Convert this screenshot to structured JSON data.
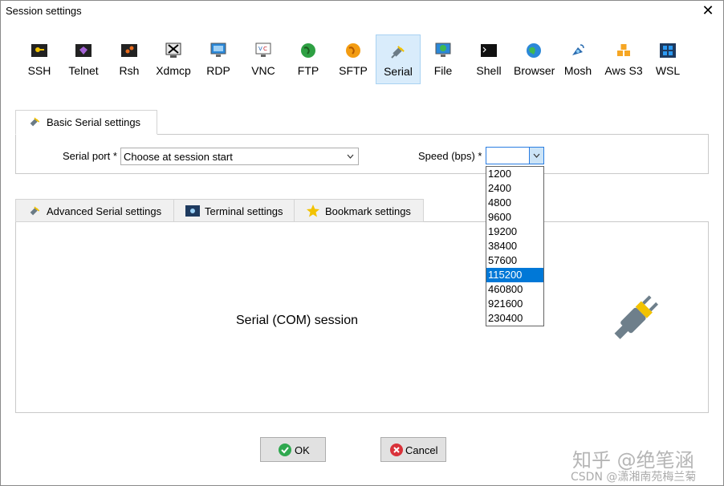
{
  "window": {
    "title": "Session settings"
  },
  "toolbar": {
    "items": [
      {
        "label": "SSH",
        "icon": "key-icon"
      },
      {
        "label": "Telnet",
        "icon": "telnet-icon"
      },
      {
        "label": "Rsh",
        "icon": "rsh-icon"
      },
      {
        "label": "Xdmcp",
        "icon": "xdmcp-icon"
      },
      {
        "label": "RDP",
        "icon": "rdp-monitor-icon"
      },
      {
        "label": "VNC",
        "icon": "vnc-monitor-icon"
      },
      {
        "label": "FTP",
        "icon": "ftp-globe-icon"
      },
      {
        "label": "SFTP",
        "icon": "sftp-globe-icon"
      },
      {
        "label": "Serial",
        "icon": "plug-icon"
      },
      {
        "label": "File",
        "icon": "file-monitor-icon"
      },
      {
        "label": "Shell",
        "icon": "terminal-icon"
      },
      {
        "label": "Browser",
        "icon": "globe-icon"
      },
      {
        "label": "Mosh",
        "icon": "satellite-icon"
      },
      {
        "label": "Aws S3",
        "icon": "aws-boxes-icon"
      },
      {
        "label": "WSL",
        "icon": "windows-icon"
      }
    ],
    "active": "Serial"
  },
  "basic_tab": {
    "label": "Basic Serial settings"
  },
  "basic": {
    "serial_port_label": "Serial port *",
    "serial_port_value": "Choose at session start",
    "speed_label": "Speed (bps) *",
    "speed_value": "",
    "speed_options": [
      "1200",
      "2400",
      "4800",
      "9600",
      "19200",
      "38400",
      "57600",
      "115200",
      "460800",
      "921600",
      "230400"
    ],
    "speed_highlighted": "115200"
  },
  "lower_tabs": [
    {
      "label": "Advanced Serial settings",
      "icon": "plug-icon"
    },
    {
      "label": "Terminal settings",
      "icon": "terminal-settings-icon"
    },
    {
      "label": "Bookmark settings",
      "icon": "star-icon"
    }
  ],
  "main": {
    "description": "Serial (COM) session"
  },
  "buttons": {
    "ok": "OK",
    "cancel": "Cancel"
  },
  "watermark": {
    "line1": "知乎 @绝笔涵",
    "line2": "CSDN @潇湘南苑梅兰菊"
  },
  "colors": {
    "accent": "#0078d7",
    "active_tool_bg": "#d9ecfb",
    "ok_green": "#2fa84f",
    "cancel_red": "#d9323a"
  }
}
